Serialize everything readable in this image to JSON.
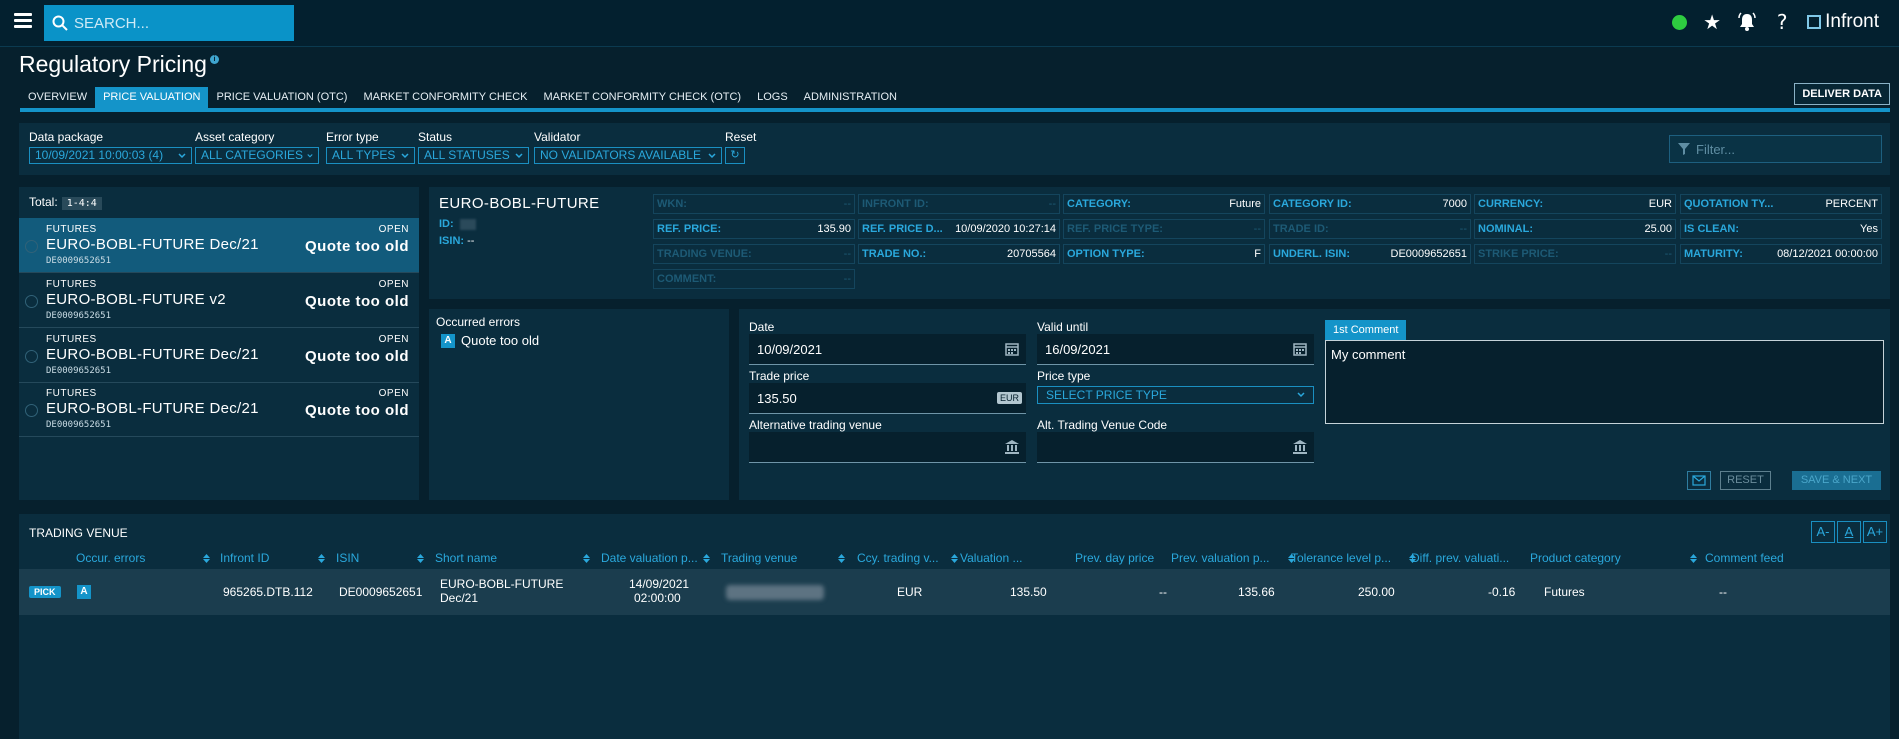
{
  "header": {
    "search_placeholder": "SEARCH...",
    "brand": "Infront",
    "status_color": "#2ecc40"
  },
  "page": {
    "title": "Regulatory Pricing",
    "tabs": [
      {
        "label": "OVERVIEW",
        "active": false
      },
      {
        "label": "PRICE VALUATION",
        "active": true
      },
      {
        "label": "PRICE VALUATION (OTC)",
        "active": false
      },
      {
        "label": "MARKET CONFORMITY CHECK",
        "active": false
      },
      {
        "label": "MARKET CONFORMITY CHECK (OTC)",
        "active": false
      },
      {
        "label": "LOGS",
        "active": false
      },
      {
        "label": "ADMINISTRATION",
        "active": false
      }
    ],
    "deliver_label": "DELIVER DATA"
  },
  "filters": {
    "data_package": {
      "label": "Data package",
      "value": "10/09/2021 10:00:03 (4)"
    },
    "asset_category": {
      "label": "Asset category",
      "value": "ALL CATEGORIES"
    },
    "error_type": {
      "label": "Error type",
      "value": "ALL TYPES"
    },
    "status": {
      "label": "Status",
      "value": "ALL STATUSES"
    },
    "validator": {
      "label": "Validator",
      "value": "NO VALIDATORS AVAILABLE"
    },
    "reset_label": "Reset",
    "filter_placeholder": "Filter..."
  },
  "list": {
    "total_label": "Total:",
    "total_value": "1-4:4",
    "items": [
      {
        "category": "FUTURES",
        "name": "EURO-BOBL-FUTURE Dec/21",
        "isin": "DE0009652651",
        "status": "OPEN",
        "message": "Quote too old"
      },
      {
        "category": "FUTURES",
        "name": "EURO-BOBL-FUTURE v2",
        "isin": "DE0009652651",
        "status": "OPEN",
        "message": "Quote too old"
      },
      {
        "category": "FUTURES",
        "name": "EURO-BOBL-FUTURE Dec/21",
        "isin": "DE0009652651",
        "status": "OPEN",
        "message": "Quote too old"
      },
      {
        "category": "FUTURES",
        "name": "EURO-BOBL-FUTURE Dec/21",
        "isin": "DE0009652651",
        "status": "OPEN",
        "message": "Quote too old"
      }
    ]
  },
  "detail": {
    "name": "EURO-BOBL-FUTURE",
    "id_label": "ID:",
    "isin_label": "ISIN:",
    "isin_value": "--",
    "cells": [
      {
        "label": "WKN:",
        "value": "--"
      },
      {
        "label": "INFRONT ID:",
        "value": "--"
      },
      {
        "label": "CATEGORY:",
        "value": "Future"
      },
      {
        "label": "CATEGORY ID:",
        "value": "7000"
      },
      {
        "label": "CURRENCY:",
        "value": "EUR"
      },
      {
        "label": "QUOTATION TY...",
        "value": "PERCENT"
      },
      {
        "label": "REF. PRICE:",
        "value": "135.90"
      },
      {
        "label": "REF. PRICE D...",
        "value": "10/09/2020 10:27:14"
      },
      {
        "label": "REF. PRICE TYPE:",
        "value": "--"
      },
      {
        "label": "TRADE ID:",
        "value": "--"
      },
      {
        "label": "NOMINAL:",
        "value": "25.00"
      },
      {
        "label": "IS CLEAN:",
        "value": "Yes"
      },
      {
        "label": "TRADING VENUE:",
        "value": "--"
      },
      {
        "label": "TRADE NO.:",
        "value": "20705564"
      },
      {
        "label": "OPTION TYPE:",
        "value": "F"
      },
      {
        "label": "UNDERL. ISIN:",
        "value": "DE0009652651"
      },
      {
        "label": "STRIKE PRICE:",
        "value": "--"
      },
      {
        "label": "MATURITY:",
        "value": "08/12/2021 00:00:00"
      },
      {
        "label": "COMMENT:",
        "value": "--"
      }
    ]
  },
  "errors": {
    "title": "Occurred errors",
    "badge": "A",
    "item": "Quote too old"
  },
  "edit": {
    "date_label": "Date",
    "date_value": "10/09/2021",
    "valid_until_label": "Valid until",
    "valid_until_value": "16/09/2021",
    "trade_price_label": "Trade price",
    "trade_price_value": "135.50",
    "currency_tag": "EUR",
    "price_type_label": "Price type",
    "price_type_value": "SELECT PRICE TYPE",
    "alt_venue_label": "Alternative trading venue",
    "alt_venue_code_label": "Alt. Trading Venue Code",
    "comment_tab": "1st Comment",
    "comment_value": "My comment",
    "reset_label": "RESET",
    "save_label": "SAVE & NEXT"
  },
  "venue": {
    "title": "TRADING VENUE",
    "font_buttons": [
      "A-",
      "A",
      "A+"
    ],
    "columns": [
      "Occur. errors",
      "Infront ID",
      "ISIN",
      "Short name",
      "Date valuation p...",
      "Trading venue",
      "Ccy. trading v...",
      "Valuation ...",
      "Prev. day price",
      "Prev. valuation p...",
      "Tolerance level p...",
      "Diff. prev. valuati...",
      "Product category",
      "Comment feed"
    ],
    "row": {
      "pick": "PICK",
      "error_badge": "A",
      "infront_id": "965265.DTB.112",
      "isin": "DE0009652651",
      "short_name_1": "EURO-BOBL-FUTURE",
      "short_name_2": "Dec/21",
      "date_1": "14/09/2021",
      "date_2": "02:00:00",
      "ccy": "EUR",
      "valuation": "135.50",
      "prev_day_price": "--",
      "prev_valuation": "135.66",
      "tolerance": "250.00",
      "diff": "-0.16",
      "product_category": "Futures",
      "comment_feed": "--"
    }
  }
}
